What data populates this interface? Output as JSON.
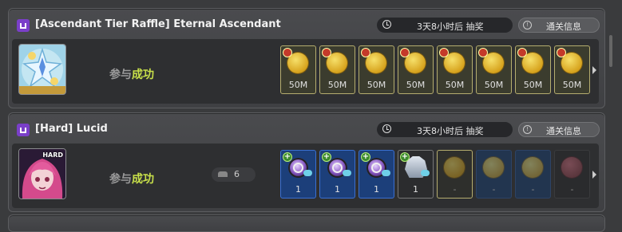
{
  "panels": [
    {
      "title": "[Ascendant Tier Raffle] Eternal Ascendant",
      "timer": "3天8小时后 抽奖",
      "info": "通关信息",
      "status_prefix": "参与",
      "status_main": "成功",
      "rewards": [
        {
          "qty": "50M",
          "icon": "meso-coin-icon"
        },
        {
          "qty": "50M",
          "icon": "meso-coin-icon"
        },
        {
          "qty": "50M",
          "icon": "meso-coin-icon"
        },
        {
          "qty": "50M",
          "icon": "meso-coin-icon"
        },
        {
          "qty": "50M",
          "icon": "meso-coin-icon"
        },
        {
          "qty": "50M",
          "icon": "meso-coin-icon"
        },
        {
          "qty": "50M",
          "icon": "meso-coin-icon"
        },
        {
          "qty": "50M",
          "icon": "meso-coin-icon"
        }
      ]
    },
    {
      "title": "[Hard] Lucid",
      "timer": "3天8小时后 抽奖",
      "info": "通关信息",
      "status_prefix": "参与",
      "status_main": "成功",
      "party_count": "6",
      "boss_badge": "HARD",
      "rewards": [
        {
          "qty": "1",
          "icon": "purple-orb-icon"
        },
        {
          "qty": "1",
          "icon": "purple-orb-icon"
        },
        {
          "qty": "1",
          "icon": "purple-orb-icon"
        },
        {
          "qty": "1",
          "icon": "robot-pet-icon"
        },
        {
          "qty": "-",
          "icon": "meso-coin-icon"
        },
        {
          "qty": "-",
          "icon": "meso-coin-icon"
        },
        {
          "qty": "-",
          "icon": "meso-coin-icon"
        },
        {
          "qty": "-",
          "icon": "pink-coin-icon"
        }
      ]
    }
  ]
}
